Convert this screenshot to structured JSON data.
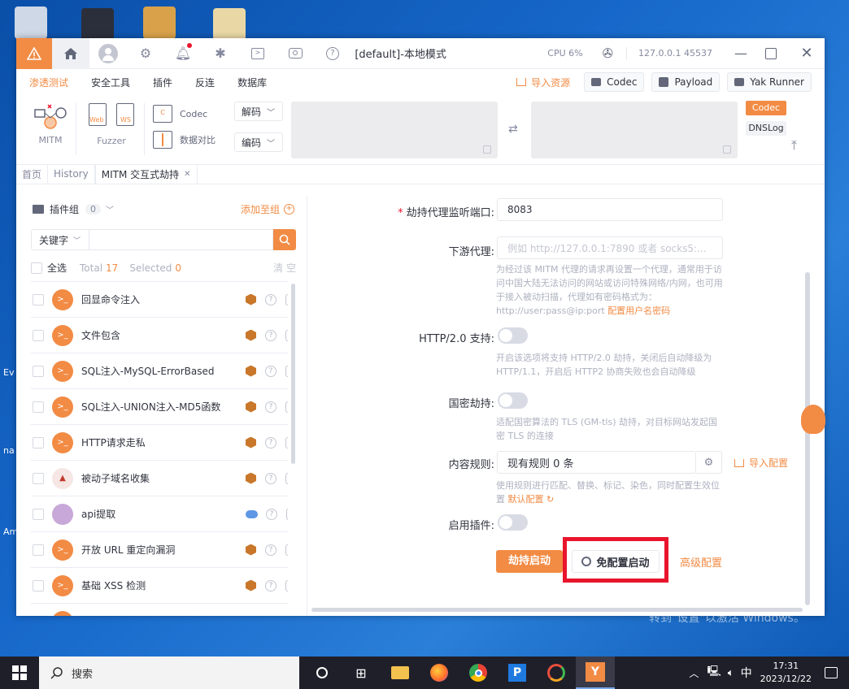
{
  "desktop": {
    "labels": [
      "Ev",
      "na",
      "Am"
    ],
    "watermark_title": "激活 Windows",
    "watermark_sub": "转到\"设置\"以激活 Windows。"
  },
  "titlebar": {
    "title": "[default]-本地模式",
    "cpu": "CPU 6%",
    "address": "127.0.0.1 45537"
  },
  "menu": {
    "items": [
      "渗透测试",
      "安全工具",
      "插件",
      "反连",
      "数据库"
    ],
    "active": "渗透测试",
    "import": "导入资源",
    "codec": "Codec",
    "payload": "Payload",
    "yak_runner": "Yak Runner"
  },
  "tools": {
    "mitm": "MITM",
    "fuzzer": "Fuzzer",
    "web": "Web",
    "ws": "WS",
    "codec": "Codec",
    "compare": "数据对比",
    "decode": "解码",
    "encode": "编码",
    "codec_tag": "Codec",
    "dnslog_tag": "DNSLog"
  },
  "tabs": [
    {
      "label": "首页"
    },
    {
      "label": "History"
    },
    {
      "label": "MITM 交互式劫持"
    }
  ],
  "left": {
    "group_label": "插件组",
    "group_count": "0",
    "add_group": "添加至组",
    "keyword": "关键字",
    "select_all": "全选",
    "total_label": "Total",
    "total": "17",
    "selected_label": "Selected",
    "selected": "0",
    "clear": "清 空",
    "plugins": [
      {
        "name": "回显命令注入",
        "badge": "v"
      },
      {
        "name": "文件包含",
        "badge": "v"
      },
      {
        "name": "SQL注入-MySQL-ErrorBased",
        "badge": "v"
      },
      {
        "name": "SQL注入-UNION注入-MD5函数",
        "badge": "v"
      },
      {
        "name": "HTTP请求走私",
        "badge": "v"
      },
      {
        "name": "被动子域名收集",
        "badge": "v"
      },
      {
        "name": "api提取",
        "badge": "cloud"
      },
      {
        "name": "开放 URL 重定向漏洞",
        "badge": "v"
      },
      {
        "name": "基础 XSS 检测",
        "badge": "v"
      }
    ]
  },
  "form": {
    "port_label": "劫持代理监听端口:",
    "port_value": "8083",
    "downstream_label": "下游代理:",
    "downstream_placeholder": "例如 http://127.0.0.1:7890 或者 socks5:...",
    "downstream_help": "为经过该 MITM 代理的请求再设置一个代理，通常用于访问中国大陆无法访问的网站或访问特殊网络/内网，也可用于接入被动扫描，代理如有密码格式为：http://user:pass@ip:port",
    "downstream_link": "配置用户名密码",
    "http2_label": "HTTP/2.0 支持:",
    "http2_help": "开启该选项将支持 HTTP/2.0 劫持，关闭后自动降级为 HTTP/1.1，开启后 HTTP2 协商失败也会自动降级",
    "gm_label": "国密劫持:",
    "gm_help": "适配国密算法的 TLS (GM-tls) 劫持，对目标网站发起国密 TLS 的连接",
    "rules_label": "内容规则:",
    "rules_value": "现有规则 0 条",
    "rules_import": "导入配置",
    "rules_help": "使用规则进行匹配、替换、标记、染色，同时配置生效位置",
    "rules_default": "默认配置",
    "plugin_label": "启用插件:",
    "start_btn": "劫持启动",
    "free_start_btn": "免配置启动",
    "advanced_btn": "高级配置"
  },
  "taskbar": {
    "search": "搜索",
    "time": "17:31",
    "date": "2023/12/22",
    "ime": "中"
  },
  "colors": {
    "accent": "#f28b44",
    "highlight_box": "#e8152c"
  }
}
